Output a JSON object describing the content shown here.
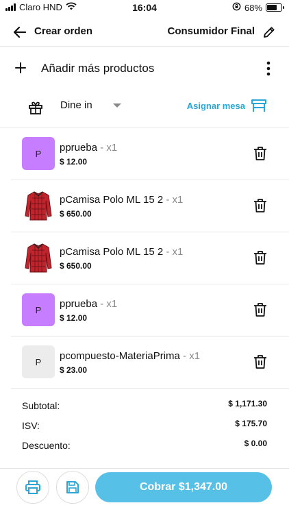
{
  "status_bar": {
    "carrier": "Claro HND",
    "time": "16:04",
    "battery": "68%",
    "battery_level": 0.68
  },
  "header": {
    "title": "Crear orden",
    "customer": "Consumidor Final"
  },
  "actions": {
    "add_products": "Añadir más productos"
  },
  "order_type": {
    "selected": "Dine in",
    "assign_table": "Asignar mesa"
  },
  "items": [
    {
      "name": "pprueba",
      "qty": " - x1",
      "price": "$ 12.00",
      "thumb": "P",
      "thumb_style": "purple"
    },
    {
      "name": "pCamisa Polo ML 15 2",
      "qty": " - x1",
      "price": "$ 650.00",
      "thumb": "",
      "thumb_style": "shirt"
    },
    {
      "name": "pCamisa Polo ML 15 2",
      "qty": " - x1",
      "price": "$ 650.00",
      "thumb": "",
      "thumb_style": "shirt"
    },
    {
      "name": "pprueba",
      "qty": " - x1",
      "price": "$ 12.00",
      "thumb": "P",
      "thumb_style": "purple"
    },
    {
      "name": "pcompuesto-MateriaPrima",
      "qty": " - x1",
      "price": "$ 23.00",
      "thumb": "P",
      "thumb_style": "gray"
    }
  ],
  "totals": {
    "subtotal_label": "Subtotal:",
    "subtotal": "$ 1,171.30",
    "tax_label": "ISV:",
    "tax": "$ 175.70",
    "discount_label": "Descuento:",
    "discount": "$ 0.00"
  },
  "footer": {
    "pay_label": "Cobrar $1,347.00"
  },
  "colors": {
    "accent": "#56c0e6",
    "link": "#2aa7d6",
    "purple_thumb": "#c77dff",
    "shirt_red": "#c0252e"
  },
  "icons": [
    "back-arrow-icon",
    "pencil-icon",
    "plus-icon",
    "more-vertical-icon",
    "gift-icon",
    "table-icon",
    "trash-icon",
    "printer-icon",
    "save-icon",
    "shirt-icon"
  ]
}
